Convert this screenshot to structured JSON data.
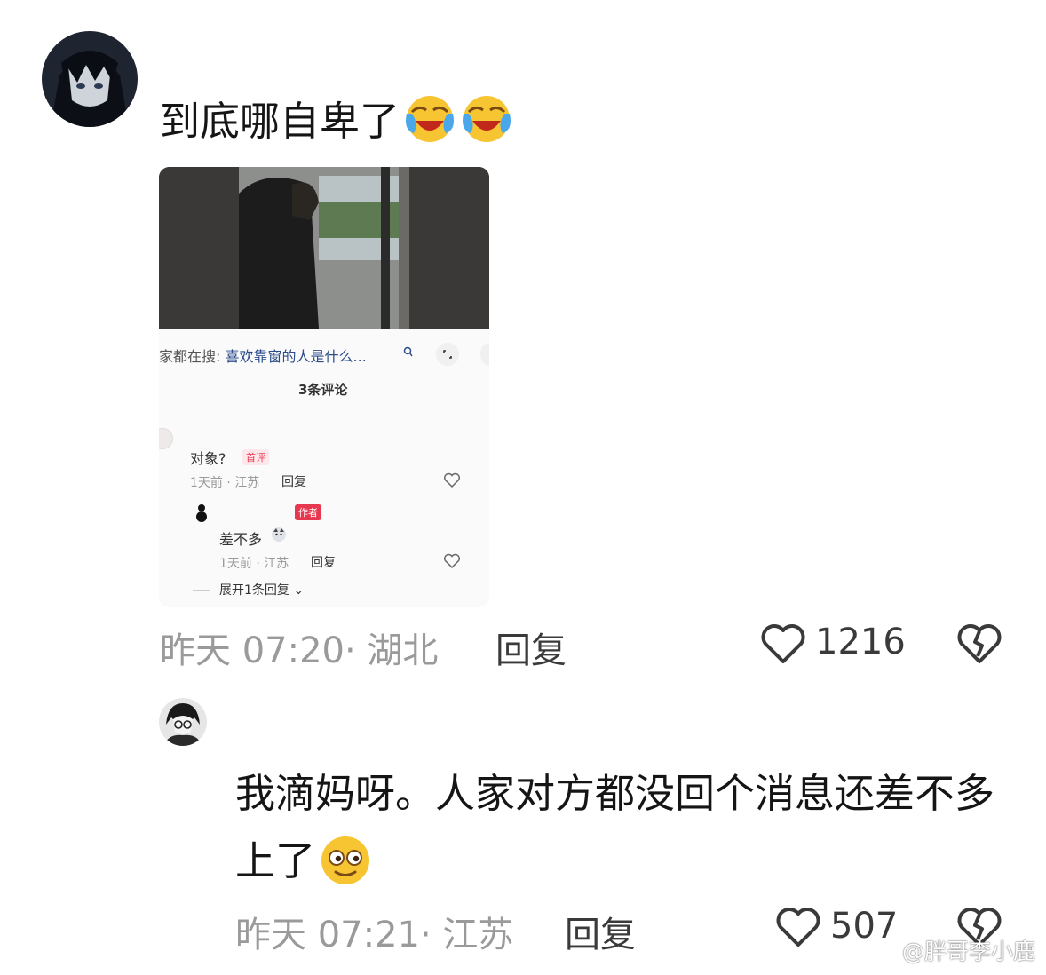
{
  "comment1": {
    "text": "到底哪自卑了",
    "emoji_icons": [
      "tears-of-joy-emoji-icon",
      "tears-of-joy-emoji-icon"
    ],
    "time_location": "昨天 07:20· 湖北",
    "reply_label": "回复",
    "like_count": "1216"
  },
  "screenshot": {
    "search_prefix": "家都在搜:",
    "search_query": "喜欢靠窗的人是什么...",
    "comments_title": "3条评论",
    "c1_text": "对象?",
    "c1_badge": "首评",
    "c1_meta": "1天前 · 江苏",
    "c1_reply": "回复",
    "c2_badge": "作者",
    "c2_text": "差不多",
    "c2_meta": "1天前 · 江苏",
    "c2_reply": "回复",
    "expand_label": "展开1条回复"
  },
  "comment2": {
    "text": "我滴妈呀。人家对方都没回个消息还差不多上了",
    "emoji_icon": "smiling-face-emoji-icon",
    "time_location": "昨天 07:21· 江苏",
    "reply_label": "回复",
    "like_count": "507"
  },
  "watermark": "@胖哥李小鹿",
  "colors": {
    "text": "#151515",
    "meta": "#9a9a9a",
    "accent_link": "#2b4b8a",
    "badge_red": "#e8384f"
  }
}
